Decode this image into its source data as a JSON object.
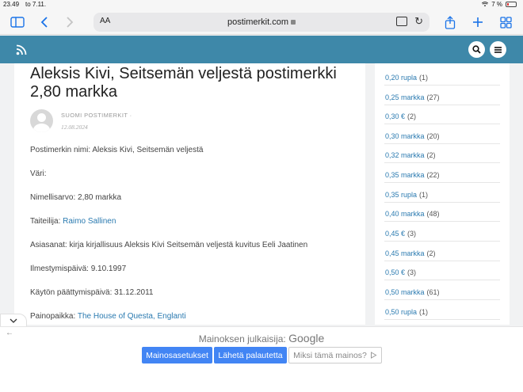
{
  "status": {
    "time": "23.49",
    "date": "to 7.11.",
    "battery": "7 %"
  },
  "browser": {
    "text_size_label": "AA",
    "url": "postimerkit.com"
  },
  "article": {
    "title": "Aleksis Kivi, Seitsemän veljestä postimerkki 2,80 markka",
    "author": "SUOMI POSTIMERKIT",
    "author_sep": "·",
    "date": "12.08.2024",
    "stamp_name_label": "Postimerkin nimi:",
    "stamp_name": "Aleksis Kivi, Seitsemän veljestä",
    "color_label": "Väri:",
    "value_label": "Nimellisarvo:",
    "value": "2,80 markka",
    "artist_label": "Taiteilija:",
    "artist": "Raimo Sallinen",
    "keywords_label": "Asiasanat:",
    "keywords": "kirja kirjallisuus Aleksis Kivi Seitsemän veljestä kuvitus Eeli Jaatinen",
    "issue_label": "Ilmestymispäivä:",
    "issue_date": "9.10.1997",
    "end_label": "Käytön päättymispäivä:",
    "end_date": "31.12.2011",
    "printer_label": "Painopaikka:",
    "printer": "The House of Questa, Englanti"
  },
  "sidebar": {
    "items": [
      {
        "label": "0,20 rupla",
        "count": "(1)"
      },
      {
        "label": "0,25 markka",
        "count": "(27)"
      },
      {
        "label": "0,30 €",
        "count": "(2)"
      },
      {
        "label": "0,30 markka",
        "count": "(20)"
      },
      {
        "label": "0,32 markka",
        "count": "(2)"
      },
      {
        "label": "0,35 markka",
        "count": "(22)"
      },
      {
        "label": "0,35 rupla",
        "count": "(1)"
      },
      {
        "label": "0,40 markka",
        "count": "(48)"
      },
      {
        "label": "0,45 €",
        "count": "(3)"
      },
      {
        "label": "0,45 markka",
        "count": "(2)"
      },
      {
        "label": "0,50 €",
        "count": "(3)"
      },
      {
        "label": "0,50 markka",
        "count": "(61)"
      },
      {
        "label": "0,50 rupla",
        "count": "(1)"
      }
    ]
  },
  "ad": {
    "publisher_label": "Mainoksen julkaisija:",
    "publisher_brand": "Google",
    "settings_button": "Mainosasetukset",
    "feedback_button": "Lähetä palautetta",
    "why_button": "Miksi tämä mainos?",
    "why_icon": "ad-choices-icon"
  },
  "colors": {
    "header": "#3e88a9",
    "link": "#2a7ab0",
    "ad_button": "#4285f4",
    "toolbar_icon": "#1a73e8"
  }
}
